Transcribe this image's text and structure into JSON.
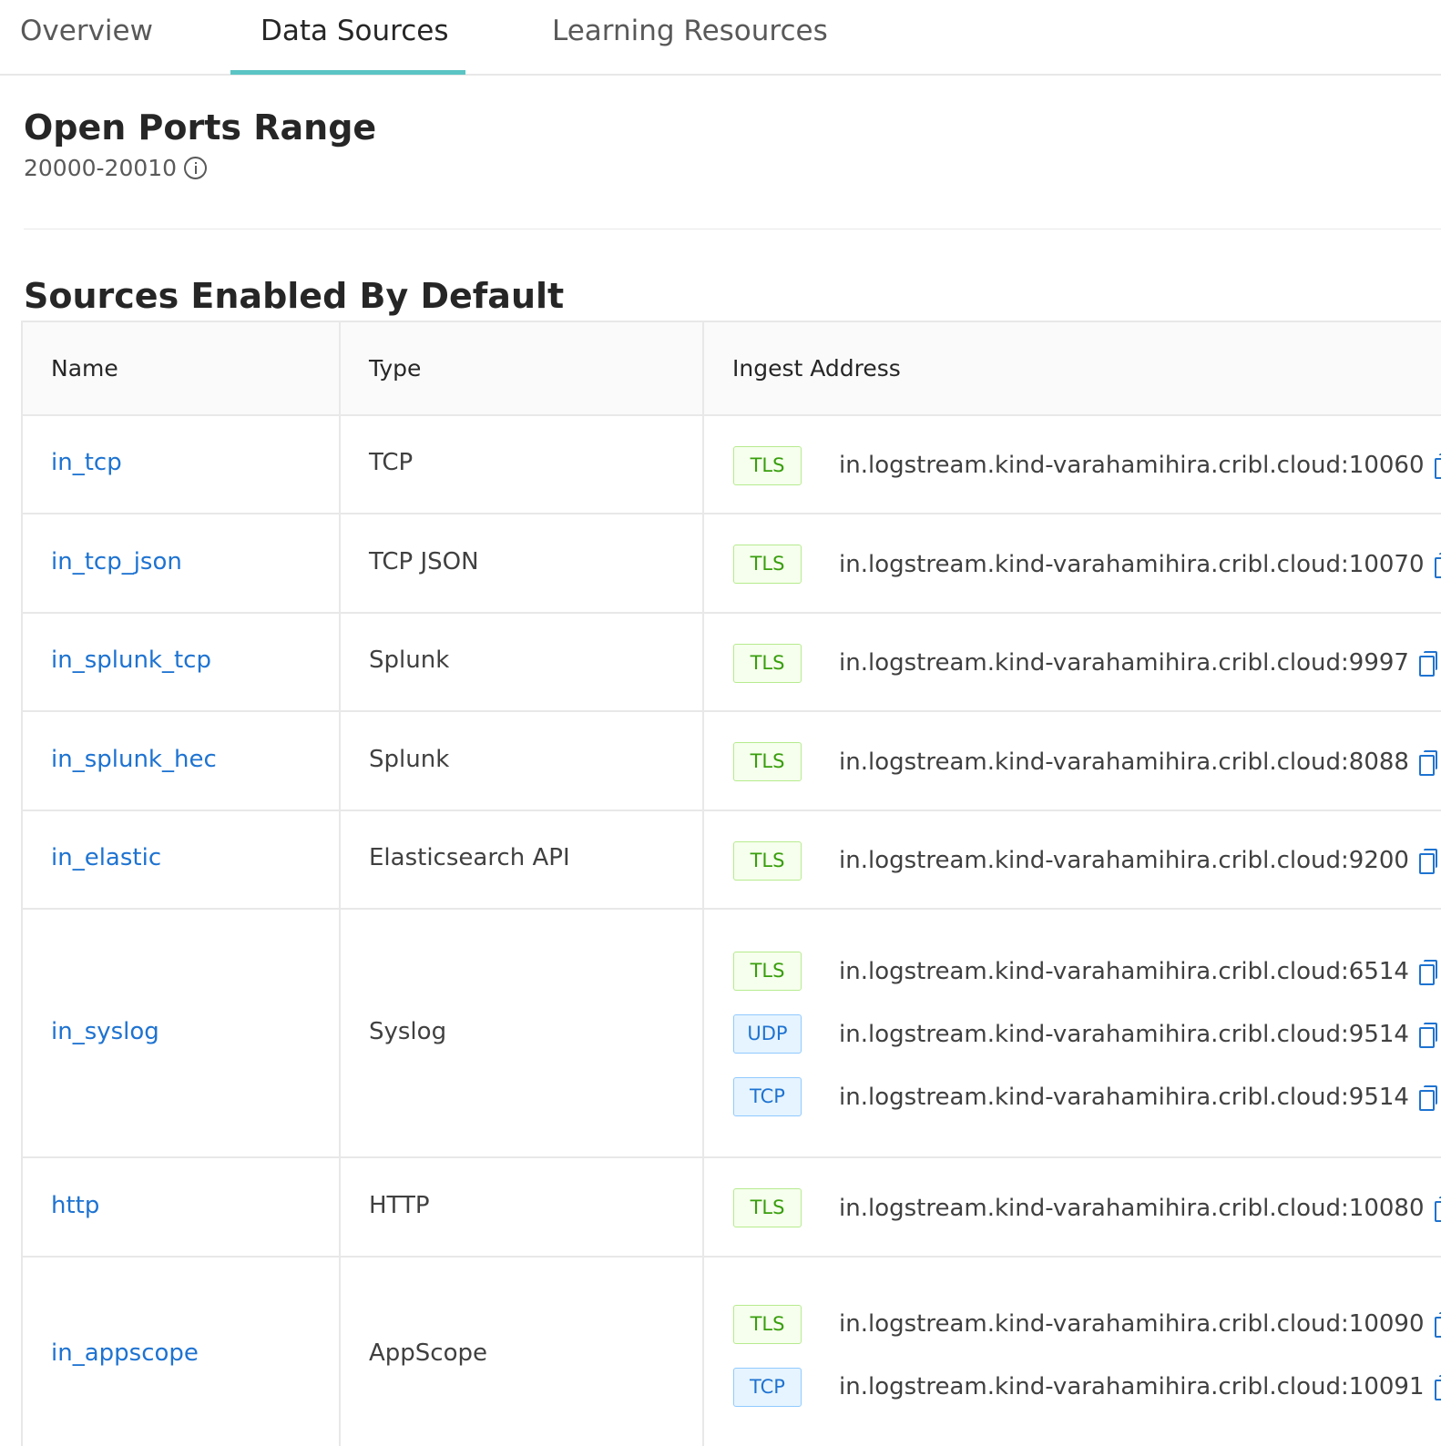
{
  "tabs": [
    "Overview",
    "Data Sources",
    "Learning Resources"
  ],
  "active_tab": "Data Sources",
  "open_ports": {
    "title": "Open Ports Range",
    "range": "20000-20010"
  },
  "sources": {
    "title": "Sources Enabled By Default",
    "columns": [
      "Name",
      "Type",
      "Ingest Address"
    ],
    "rows": [
      {
        "name": "in_tcp",
        "type": "TCP",
        "addresses": [
          {
            "protocol": "TLS",
            "address": "in.logstream.kind-varahamihira.cribl.cloud:10060"
          }
        ]
      },
      {
        "name": "in_tcp_json",
        "type": "TCP JSON",
        "addresses": [
          {
            "protocol": "TLS",
            "address": "in.logstream.kind-varahamihira.cribl.cloud:10070"
          }
        ]
      },
      {
        "name": "in_splunk_tcp",
        "type": "Splunk",
        "addresses": [
          {
            "protocol": "TLS",
            "address": "in.logstream.kind-varahamihira.cribl.cloud:9997"
          }
        ]
      },
      {
        "name": "in_splunk_hec",
        "type": "Splunk",
        "addresses": [
          {
            "protocol": "TLS",
            "address": "in.logstream.kind-varahamihira.cribl.cloud:8088"
          }
        ]
      },
      {
        "name": "in_elastic",
        "type": "Elasticsearch API",
        "addresses": [
          {
            "protocol": "TLS",
            "address": "in.logstream.kind-varahamihira.cribl.cloud:9200"
          }
        ]
      },
      {
        "name": "in_syslog",
        "type": "Syslog",
        "addresses": [
          {
            "protocol": "TLS",
            "address": "in.logstream.kind-varahamihira.cribl.cloud:6514"
          },
          {
            "protocol": "UDP",
            "address": "in.logstream.kind-varahamihira.cribl.cloud:9514"
          },
          {
            "protocol": "TCP",
            "address": "in.logstream.kind-varahamihira.cribl.cloud:9514"
          }
        ]
      },
      {
        "name": "http",
        "type": "HTTP",
        "addresses": [
          {
            "protocol": "TLS",
            "address": "in.logstream.kind-varahamihira.cribl.cloud:10080"
          }
        ]
      },
      {
        "name": "in_appscope",
        "type": "AppScope",
        "addresses": [
          {
            "protocol": "TLS",
            "address": "in.logstream.kind-varahamihira.cribl.cloud:10090"
          },
          {
            "protocol": "TCP",
            "address": "in.logstream.kind-varahamihira.cribl.cloud:10091"
          }
        ]
      }
    ]
  }
}
